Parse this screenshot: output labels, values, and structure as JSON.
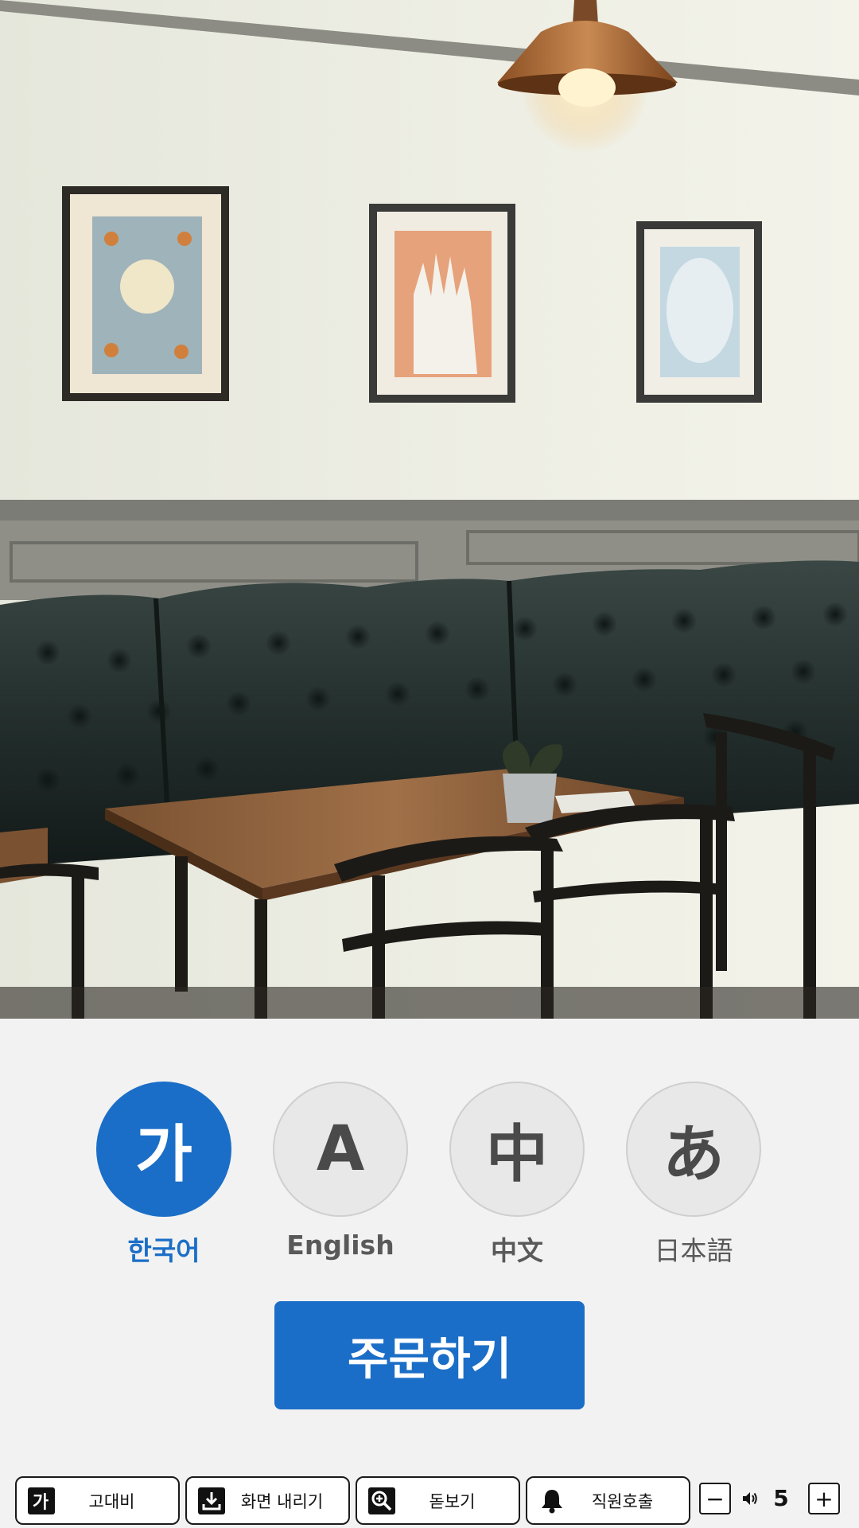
{
  "languages": [
    {
      "glyph": "가",
      "label": "한국어",
      "selected": true
    },
    {
      "glyph": "A",
      "label": "English",
      "selected": false
    },
    {
      "glyph": "中",
      "label": "中文",
      "selected": false
    },
    {
      "glyph": "あ",
      "label": "日本語",
      "selected": false
    }
  ],
  "order_button": {
    "label": "주문하기"
  },
  "accessibility": {
    "contrast": {
      "label": "고대비",
      "icon_text": "가",
      "icon": "contrast-icon"
    },
    "lower_screen": {
      "label": "화면 내리기",
      "icon": "download-tray-icon"
    },
    "magnifier": {
      "label": "돋보기",
      "icon": "zoom-in-icon"
    },
    "call_staff": {
      "label": "직원호출",
      "icon": "bell-icon"
    },
    "volume": {
      "decrease": "−",
      "increase": "+",
      "value": "5",
      "icon": "speaker-icon"
    }
  },
  "colors": {
    "accent": "#1b6ec7",
    "background": "#f2f2f2"
  }
}
